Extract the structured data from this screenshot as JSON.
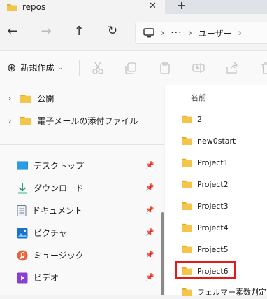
{
  "tab": {
    "title": "repos",
    "close": "✕",
    "new_tab": "+"
  },
  "nav": {
    "back": "←",
    "forward": "→",
    "up": "↑",
    "refresh": "↻",
    "address": {
      "sep": "›",
      "overflow": "···",
      "path_segment": "ユーザー"
    }
  },
  "command_bar": {
    "new_label": "新規作成",
    "new_icon": "⊕",
    "chevron": "⌄",
    "icons": [
      "cut-icon",
      "copy-icon",
      "paste-icon",
      "rename-icon",
      "share-icon",
      "delete-icon"
    ]
  },
  "left_pane": {
    "tree": [
      {
        "label": "公開",
        "chevron": "›"
      },
      {
        "label": "電子メールの添付ファイル",
        "chevron": "›"
      }
    ],
    "quick_access": [
      {
        "label": "デスクトップ",
        "icon": "desktop-icon",
        "pin": "📌"
      },
      {
        "label": "ダウンロード",
        "icon": "download-icon",
        "pin": "📌"
      },
      {
        "label": "ドキュメント",
        "icon": "document-icon",
        "pin": "📌"
      },
      {
        "label": "ピクチャ",
        "icon": "pictures-icon",
        "pin": "📌"
      },
      {
        "label": "ミュージック",
        "icon": "music-icon",
        "pin": "📌"
      },
      {
        "label": "ビデオ",
        "icon": "video-icon",
        "pin": "📌"
      }
    ]
  },
  "file_list": {
    "column_header": "名前",
    "items": [
      {
        "name": "2"
      },
      {
        "name": "new0start"
      },
      {
        "name": "Project1"
      },
      {
        "name": "Project2"
      },
      {
        "name": "Project3"
      },
      {
        "name": "Project4"
      },
      {
        "name": "Project5"
      },
      {
        "name": "Project6",
        "highlighted": true
      },
      {
        "name": "フェルマー素数判定法"
      }
    ]
  },
  "colors": {
    "folder": "#f4c54b",
    "folder_dark": "#e6a817",
    "highlight": "#e21b1b",
    "accent": "#0067c0"
  }
}
